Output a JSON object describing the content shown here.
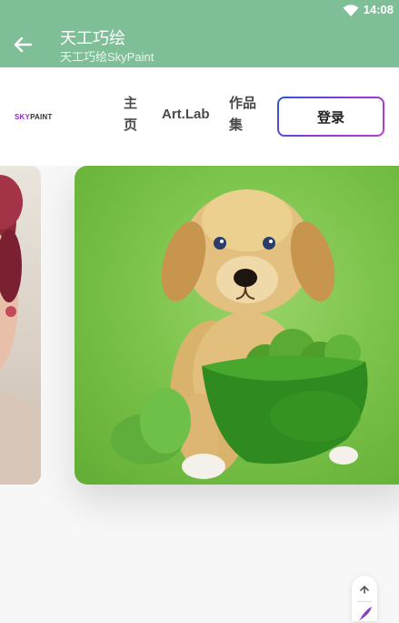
{
  "status_bar": {
    "time": "14:08"
  },
  "app_bar": {
    "title": "天工巧绘",
    "subtitle": "天工巧绘SkyPaint"
  },
  "site_nav": {
    "logo_sky": "SKY",
    "logo_paint": "PAINT",
    "home": "主页",
    "home_line1": "主",
    "home_line2": "页",
    "artlab": "Art.Lab",
    "works_line1": "作品",
    "works_line2": "集",
    "login": "登录"
  },
  "colors": {
    "app_bar": "#7fbf98",
    "login_border_start": "#2a59d6",
    "login_border_end": "#c23ad0",
    "card_green": "#7cc44b"
  },
  "carousel": {
    "left_card_icon": "portrait-image",
    "main_card_icon": "puppy-with-lettuce-bowl-image"
  }
}
